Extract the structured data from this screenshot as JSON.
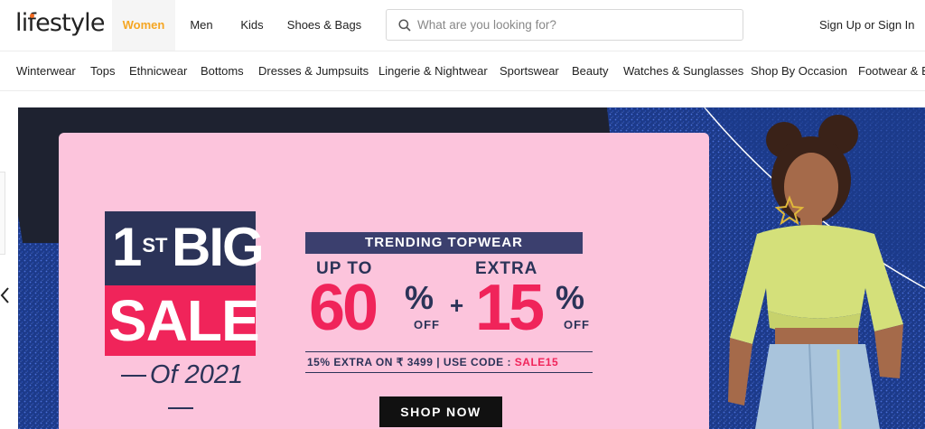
{
  "header": {
    "logo_text": "lifestyle",
    "tabs": [
      {
        "label": "Women",
        "active": true
      },
      {
        "label": "Men",
        "active": false
      },
      {
        "label": "Kids",
        "active": false
      },
      {
        "label": "Shoes & Bags",
        "active": false
      }
    ],
    "search_placeholder": "What are you looking for?",
    "signin_label": "Sign Up or Sign In"
  },
  "categories": [
    "Winterwear",
    "Tops",
    "Ethnicwear",
    "Bottoms",
    "Dresses & Jumpsuits",
    "Lingerie & Nightwear",
    "Sportswear",
    "Beauty",
    "Watches & Sunglasses",
    "Shop By Occasion",
    "Footwear & B"
  ],
  "banner": {
    "rank": "1",
    "rank_suffix": "ST",
    "big": "BIG",
    "sale": "SALE",
    "year": "Of 2021",
    "trending": "TRENDING TOPWEAR",
    "up_to": "UP TO",
    "discount": "60",
    "extra": "EXTRA",
    "extra_discount": "15",
    "percent": "%",
    "off": "OFF",
    "plus": "+",
    "code_text": "15% EXTRA ON ₹ 3499 | USE CODE : ",
    "code": "SALE15",
    "cta": "SHOP NOW"
  },
  "colors": {
    "accent": "#f5a623",
    "brand_dot": "#f36b21",
    "sale_pink": "#f0245a",
    "navy": "#2b3358",
    "card_pink": "#fcc4dc"
  },
  "icons": {
    "search": "search-icon",
    "prev": "chevron-left-icon"
  }
}
